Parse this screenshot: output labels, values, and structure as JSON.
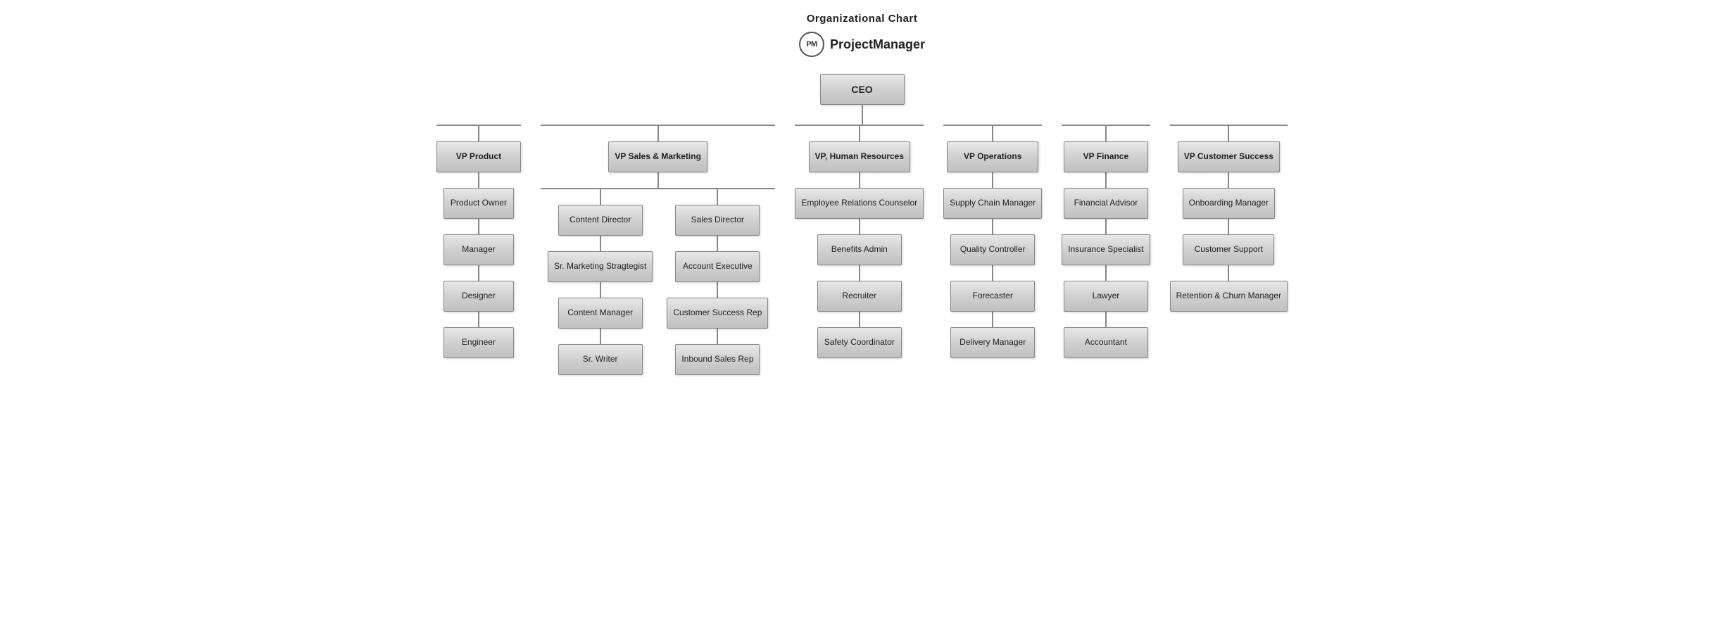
{
  "header": {
    "title": "Organizational Chart",
    "brand_logo": "PM",
    "brand_name": "ProjectManager"
  },
  "chart": {
    "ceo": "CEO",
    "vps": [
      {
        "id": "vp-product",
        "label": "VP Product",
        "children": [
          {
            "id": "product-owner",
            "label": "Product Owner",
            "children": [
              {
                "id": "manager",
                "label": "Manager",
                "children": [
                  {
                    "id": "designer",
                    "label": "Designer",
                    "children": [
                      {
                        "id": "engineer",
                        "label": "Engineer",
                        "children": []
                      }
                    ]
                  }
                ]
              }
            ]
          }
        ]
      },
      {
        "id": "vp-sales-marketing",
        "label": "VP Sales & Marketing",
        "children_groups": [
          {
            "id": "content-director",
            "label": "Content Director",
            "children": [
              {
                "id": "sr-marketing",
                "label": "Sr. Marketing Stragtegist",
                "children": []
              },
              {
                "id": "content-manager",
                "label": "Content Manager",
                "children": []
              },
              {
                "id": "sr-writer",
                "label": "Sr. Writer",
                "children": []
              }
            ]
          },
          {
            "id": "sales-director",
            "label": "Sales Director",
            "children": [
              {
                "id": "account-executive",
                "label": "Account Executive",
                "children": [
                  {
                    "id": "customer-success-rep",
                    "label": "Customer Success Rep",
                    "children": []
                  },
                  {
                    "id": "inbound-sales-rep",
                    "label": "Inbound Sales Rep",
                    "children": []
                  }
                ]
              }
            ]
          }
        ]
      },
      {
        "id": "vp-hr",
        "label": "VP, Human Resources",
        "children": [
          {
            "id": "employee-relations",
            "label": "Employee Relations Counselor",
            "children": [
              {
                "id": "benefits-admin",
                "label": "Benefits Admin",
                "children": [
                  {
                    "id": "recruiter",
                    "label": "Recruiter",
                    "children": [
                      {
                        "id": "safety-coordinator",
                        "label": "Safety Coordinator",
                        "children": []
                      }
                    ]
                  }
                ]
              }
            ]
          }
        ]
      },
      {
        "id": "vp-operations",
        "label": "VP Operations",
        "children": [
          {
            "id": "supply-chain",
            "label": "Supply Chain Manager",
            "children": [
              {
                "id": "quality-controller",
                "label": "Quality Controller",
                "children": [
                  {
                    "id": "forecaster",
                    "label": "Forecaster",
                    "children": [
                      {
                        "id": "delivery-manager",
                        "label": "Delivery Manager",
                        "children": []
                      }
                    ]
                  }
                ]
              }
            ]
          }
        ]
      },
      {
        "id": "vp-finance",
        "label": "VP Finance",
        "children": [
          {
            "id": "financial-advisor",
            "label": "Financial Advisor",
            "children": [
              {
                "id": "insurance-specialist",
                "label": "Insurance Specialist",
                "children": [
                  {
                    "id": "lawyer",
                    "label": "Lawyer",
                    "children": [
                      {
                        "id": "accountant",
                        "label": "Accountant",
                        "children": []
                      }
                    ]
                  }
                ]
              }
            ]
          }
        ]
      },
      {
        "id": "vp-customer-success",
        "label": "VP Customer Success",
        "children": [
          {
            "id": "onboarding-manager",
            "label": "Onboarding Manager",
            "children": [
              {
                "id": "customer-support",
                "label": "Customer Support",
                "children": [
                  {
                    "id": "retention-churn",
                    "label": "Retention & Churn Manager",
                    "children": []
                  }
                ]
              }
            ]
          }
        ]
      }
    ]
  }
}
